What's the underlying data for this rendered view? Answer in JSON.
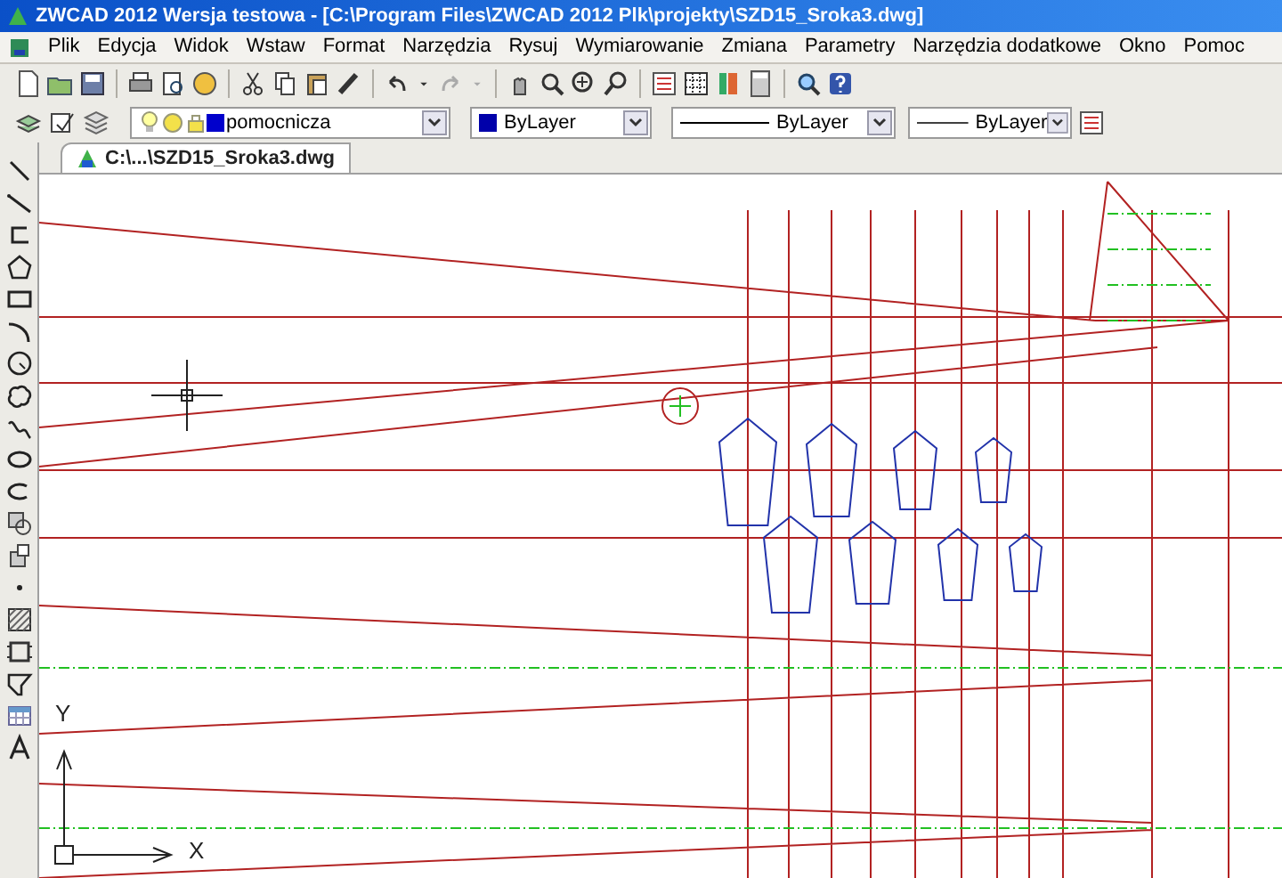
{
  "window": {
    "title": "ZWCAD 2012 Wersja testowa - [C:\\Program Files\\ZWCAD 2012 Plk\\projekty\\SZD15_Sroka3.dwg]"
  },
  "menu": [
    "Plik",
    "Edycja",
    "Widok",
    "Wstaw",
    "Format",
    "Narzędzia",
    "Rysuj",
    "Wymiarowanie",
    "Zmiana",
    "Parametry",
    "Narzędzia dodatkowe",
    "Okno",
    "Pomoc"
  ],
  "properties_bar": {
    "layer": "pomocnicza",
    "color_setting": "ByLayer",
    "linetype": "ByLayer",
    "lineweight": "ByLayer"
  },
  "tabs": [
    {
      "label": "C:\\...\\SZD15_Sroka3.dwg",
      "selected": true
    }
  ],
  "ucs": {
    "x_label": "X",
    "y_label": "Y"
  }
}
